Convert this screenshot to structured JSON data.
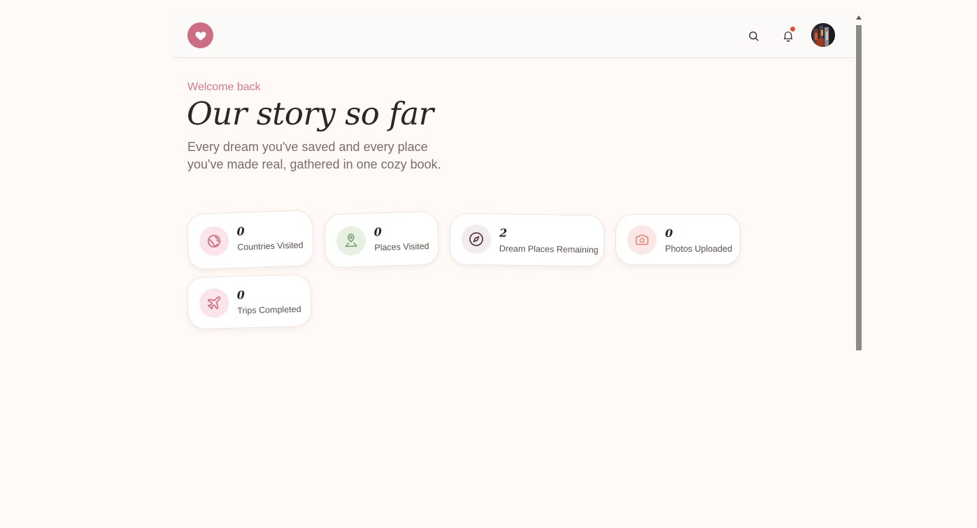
{
  "header": {
    "logo_icon": "heart-icon",
    "search_icon": "search-icon",
    "notification_icon": "bell-icon",
    "avatar_icon": "user-avatar"
  },
  "hero": {
    "welcome": "Welcome back",
    "title": "Our story so far",
    "subtitle": "Every dream you've saved and every place you've made real, gathered in one cozy book."
  },
  "stats": [
    {
      "value": "0",
      "label": "Countries Visited",
      "icon": "globe-icon"
    },
    {
      "value": "0",
      "label": "Places Visited",
      "icon": "map-pin-icon"
    },
    {
      "value": "2",
      "label": "Dream Places Remaining",
      "icon": "compass-icon"
    },
    {
      "value": "0",
      "label": "Photos Uploaded",
      "icon": "camera-icon"
    },
    {
      "value": "0",
      "label": "Trips Completed",
      "icon": "plane-icon"
    }
  ],
  "colors": {
    "accent": "#cd6d84",
    "background": "#fffaf7",
    "notification_dot": "#df4f39",
    "green": "#7ea178"
  }
}
